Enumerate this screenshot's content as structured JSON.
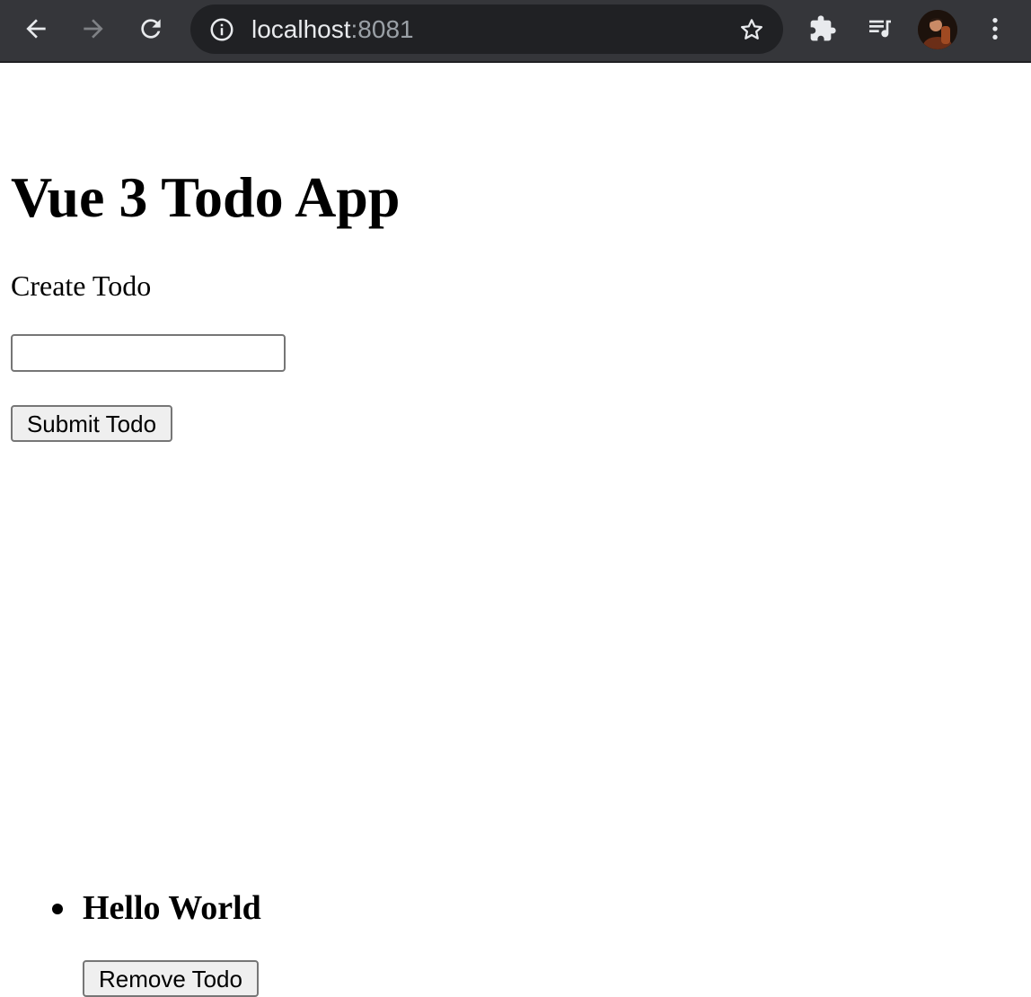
{
  "browser": {
    "url_host": "localhost",
    "url_port": ":8081",
    "icons": {
      "back": "back-arrow-icon",
      "forward": "forward-arrow-icon",
      "reload": "reload-icon",
      "info": "info-icon",
      "bookmark": "star-icon",
      "extensions": "puzzle-icon",
      "media": "playlist-icon",
      "profile": "avatar",
      "menu": "kebab-menu-icon"
    }
  },
  "page": {
    "title": "Vue 3 Todo App",
    "create_label": "Create Todo",
    "input_value": "",
    "submit_label": "Submit Todo",
    "todos": [
      {
        "text": "Hello World",
        "remove_label": "Remove Todo"
      }
    ]
  },
  "colors": {
    "toolbar_bg": "#35363a",
    "omnibox_bg": "#202124",
    "url_host": "#e8eaed",
    "url_port": "#9aa0a6",
    "button_bg": "#efefef"
  }
}
